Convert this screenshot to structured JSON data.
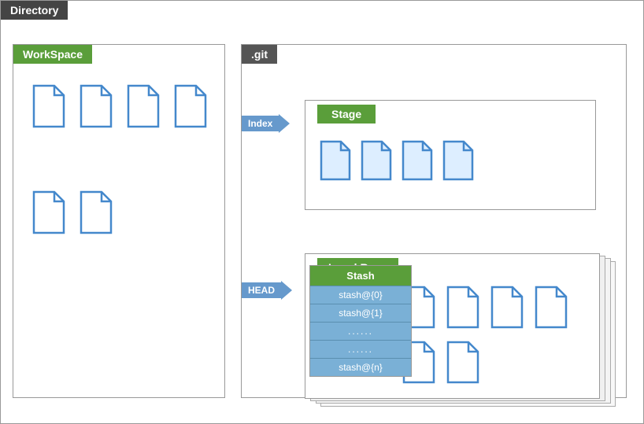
{
  "title": "Directory",
  "workspace": {
    "label": "WorkSpace",
    "files_row1_count": 4,
    "files_row2_count": 2
  },
  "git": {
    "label": ".git",
    "index_label": "Index",
    "head_label": "HEAD",
    "stage": {
      "label": "Stage",
      "files_count": 4
    },
    "localrepo": {
      "label": "Local Repo",
      "files_row1_count": 4,
      "files_row2_count": 2
    },
    "stash": {
      "header": "Stash",
      "items": [
        "stash@{0}",
        "stash@{1}",
        "......",
        "......",
        "stash@{n}"
      ]
    }
  },
  "colors": {
    "green": "#5a9e3a",
    "blue_arrow": "#6699cc",
    "file_stroke": "#4488cc",
    "file_fill": "white",
    "stash_bg": "#7ab0d6"
  }
}
